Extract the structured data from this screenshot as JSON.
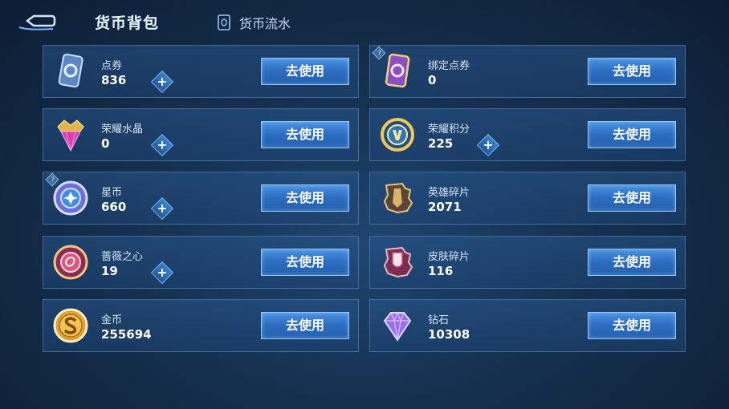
{
  "header": {
    "active_tab": "货币背包",
    "flow_tab": "货币流水"
  },
  "use_button_label": "去使用",
  "plus_label": "+",
  "hint_mark": "?",
  "currencies": [
    {
      "name": "点券",
      "amount": "836",
      "icon": "voucher-card-icon"
    },
    {
      "name": "绑定点券",
      "amount": "0",
      "icon": "bound-voucher-card-icon"
    },
    {
      "name": "荣耀水晶",
      "amount": "0",
      "icon": "glory-crystal-icon"
    },
    {
      "name": "荣耀积分",
      "amount": "225",
      "icon": "glory-points-icon"
    },
    {
      "name": "星币",
      "amount": "660",
      "icon": "star-coin-icon"
    },
    {
      "name": "英雄碎片",
      "amount": "2071",
      "icon": "hero-fragment-icon"
    },
    {
      "name": "蔷薇之心",
      "amount": "19",
      "icon": "rose-heart-icon"
    },
    {
      "name": "皮肤碎片",
      "amount": "116",
      "icon": "skin-fragment-icon"
    },
    {
      "name": "金币",
      "amount": "255694",
      "icon": "gold-coin-icon"
    },
    {
      "name": "钻石",
      "amount": "10308",
      "icon": "diamond-icon"
    }
  ],
  "colors": {
    "accent": "#4a91e0",
    "card_border": "#6ea0dc",
    "background": "#15304f"
  }
}
